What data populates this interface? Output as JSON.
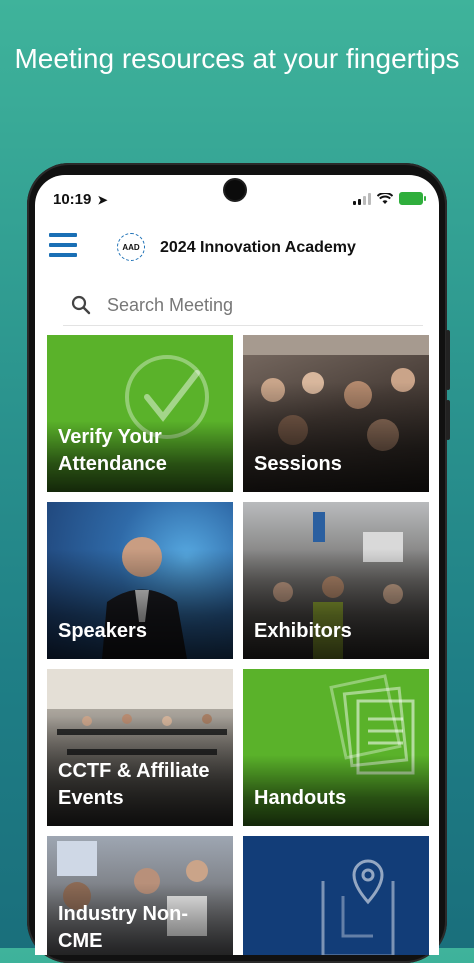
{
  "headline": "Meeting resources at your fingertips",
  "status_bar": {
    "time": "10:19",
    "icons": [
      "location-arrow-icon",
      "signal-icon",
      "wifi-icon",
      "battery-charging-icon"
    ]
  },
  "app_header": {
    "menu_icon": "hamburger-menu-icon",
    "logo_text": "AAD",
    "title": "2024 Innovation Academy"
  },
  "search": {
    "placeholder": "Search Meeting",
    "value": ""
  },
  "tiles": [
    {
      "label": "Verify Your Attendance",
      "bg": "#5ab22a",
      "icon": "checkmark-circle-icon"
    },
    {
      "label": "Sessions",
      "bg": "#5a5048",
      "icon": "crowd-photo"
    },
    {
      "label": "Speakers",
      "bg": "#3b6da3",
      "icon": "speaker-photo"
    },
    {
      "label": "Exhibitors",
      "bg": "#6b6a6c",
      "icon": "exhibit-hall-photo"
    },
    {
      "label": "CCTF & Affiliate Events",
      "bg": "#6a6863",
      "icon": "meeting-room-photo"
    },
    {
      "label": "Handouts",
      "bg": "#5ab22a",
      "icon": "documents-icon"
    },
    {
      "label": "Industry Non-CME",
      "bg": "#7a7e86",
      "icon": "microscope-photo"
    },
    {
      "label": "",
      "bg": "#123d78",
      "icon": "map-pin-icon"
    }
  ],
  "colors": {
    "accent": "#1a6fb5",
    "green_tile": "#5ab22a",
    "navy_tile": "#123d78"
  }
}
